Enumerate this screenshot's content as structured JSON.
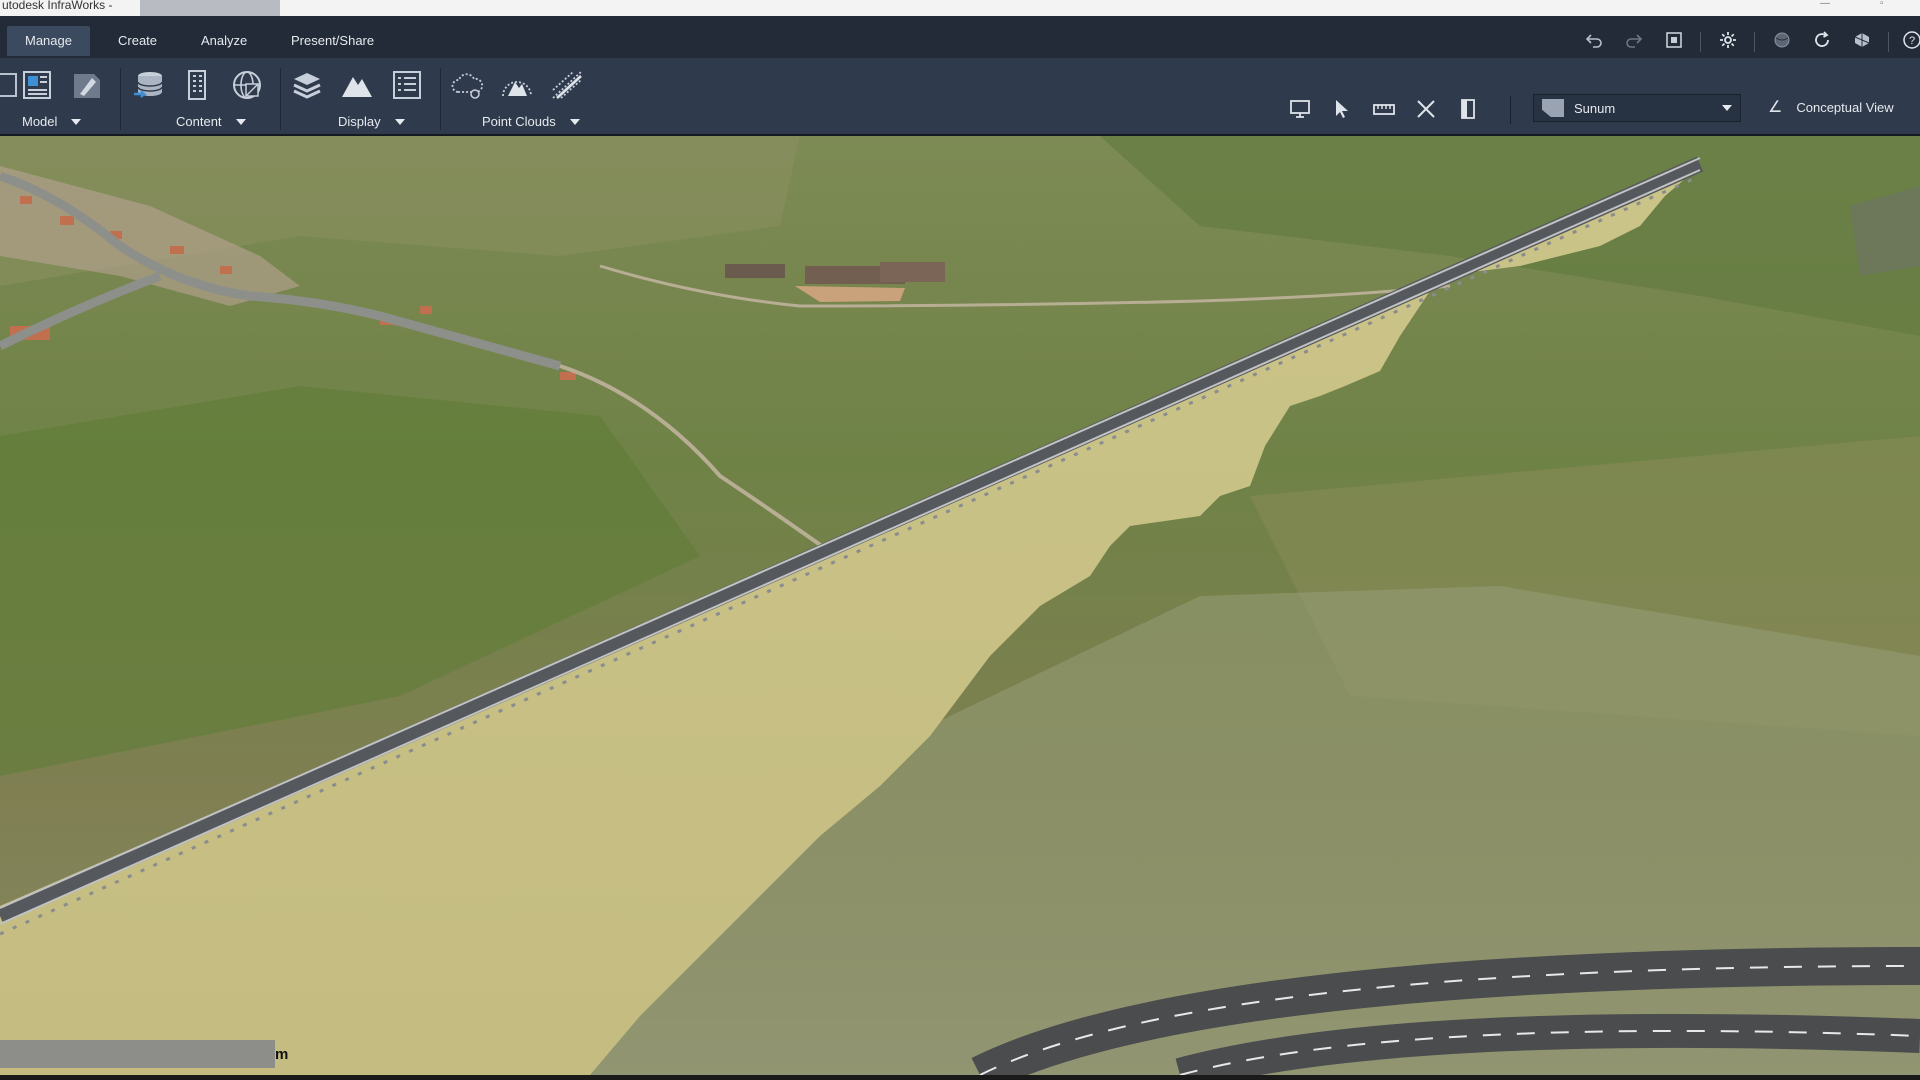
{
  "window": {
    "title": "utodesk InfraWorks -"
  },
  "tabs": [
    {
      "label": "Manage",
      "active": true
    },
    {
      "label": "Create",
      "active": false
    },
    {
      "label": "Analyze",
      "active": false
    },
    {
      "label": "Present/Share",
      "active": false
    }
  ],
  "ribbon": {
    "panels": [
      {
        "label": "Model"
      },
      {
        "label": "Content"
      },
      {
        "label": "Display"
      },
      {
        "label": "Point Clouds"
      }
    ]
  },
  "view_controls": {
    "style_value": "Sunum",
    "view_mode": "Conceptual View"
  },
  "viewport": {
    "scale_unit": "m"
  },
  "colors": {
    "accent_tab": "#3b4a5e",
    "ribbon_bg": "#2f3b4c",
    "corridor_fill": "#c4bc80"
  }
}
